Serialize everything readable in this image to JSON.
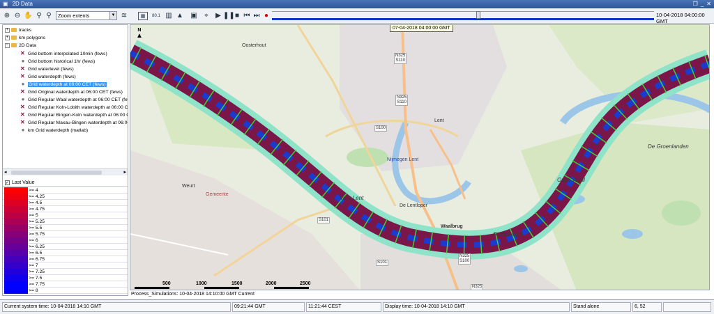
{
  "window": {
    "title": "2D Data",
    "controls": [
      "restore-icon",
      "minimize-icon",
      "close-icon"
    ]
  },
  "toolbar": {
    "zoom_select_value": "Zoom extents",
    "zoom_percent": "80.1",
    "slider_tooltip": "07-04-2018 04:00:00 GMT",
    "slider_end_label": "10-04-2018 04:00:00 GMT",
    "slider_position_fraction": 0.54,
    "icons": [
      "zoom-in-icon",
      "zoom-out-icon",
      "pan-hand-icon",
      "zoom-window-icon",
      "zoom-previous-icon",
      "layers-icon",
      "grid-icon",
      "opacity-icon",
      "triangle-icon",
      "video-icon",
      "crosshair-icon",
      "play-icon",
      "pause-icon",
      "stop-icon",
      "skip-start-icon",
      "skip-end-icon",
      "record-icon"
    ]
  },
  "tree": {
    "items": [
      {
        "label": "tracks",
        "icon": "folder-icon",
        "level": 0
      },
      {
        "label": "km polygons",
        "icon": "folder-icon",
        "level": 0
      },
      {
        "label": "2D Data",
        "icon": "folder-icon",
        "level": 0
      },
      {
        "label": "Grid bottom interpolated 10min (fews)",
        "icon": "grid-x-icon",
        "level": 1
      },
      {
        "label": "Grid bottom historical 1hr (fews)",
        "icon": "point-icon",
        "level": 1
      },
      {
        "label": "Grid waterlevel (fews)",
        "icon": "grid-x-icon",
        "level": 1
      },
      {
        "label": "Grid waterdepth (fews)",
        "icon": "grid-x-icon",
        "level": 1
      },
      {
        "label": "Grid waterdepth at 06:00 CET (fews)",
        "icon": "point-icon",
        "level": 1,
        "selected": true
      },
      {
        "label": "Grid Original waterdepth at 06:00 CET (fews)",
        "icon": "grid-x-icon",
        "level": 1
      },
      {
        "label": "Grid Regular Waal waterdepth at 06:00 CET (fews)",
        "icon": "point-icon",
        "level": 1
      },
      {
        "label": "Grid Regular Koln-Lobith waterdepth at 06:00 CET",
        "icon": "grid-x-icon",
        "level": 1
      },
      {
        "label": "Grid Regular Bingen-Koln waterdepth at 06:00 CE",
        "icon": "grid-x-icon",
        "level": 1
      },
      {
        "label": "Grid Regular Maxau-Bingen waterdepth at 06:00",
        "icon": "grid-x-icon",
        "level": 1
      },
      {
        "label": "km Grid waterdepth (matlab)",
        "icon": "point-icon",
        "level": 1
      }
    ]
  },
  "legend": {
    "header": "Last Value",
    "checked": true,
    "entries": [
      {
        "label": ">= 4",
        "color": "#ff0000"
      },
      {
        "label": ">= 4.25",
        "color": "#ee0011"
      },
      {
        "label": ">= 4.5",
        "color": "#dd0022"
      },
      {
        "label": ">= 4.75",
        "color": "#cc0033"
      },
      {
        "label": ">= 5",
        "color": "#bb0044"
      },
      {
        "label": ">= 5.25",
        "color": "#aa0055"
      },
      {
        "label": ">= 5.5",
        "color": "#990066"
      },
      {
        "label": ">= 5.75",
        "color": "#880077"
      },
      {
        "label": ">= 6",
        "color": "#770088"
      },
      {
        "label": ">= 6.25",
        "color": "#660099"
      },
      {
        "label": ">= 6.5",
        "color": "#5500aa"
      },
      {
        "label": ">= 6.75",
        "color": "#4400bb"
      },
      {
        "label": ">= 7",
        "color": "#3300cc"
      },
      {
        "label": ">= 7.25",
        "color": "#2200dd"
      },
      {
        "label": ">= 7.5",
        "color": "#1100ee"
      },
      {
        "label": ">= 7.75",
        "color": "#0000ff"
      },
      {
        "label": ">= 8",
        "color": "#0000ff"
      }
    ]
  },
  "map": {
    "north_label": "N",
    "places": {
      "veur_lent": "Veur Lent",
      "stadswaard": "Stadswaard",
      "oude_waal": "Oude Waal",
      "de_groenlanden": "De Groenlanden",
      "waalbrug": "Waalbrug",
      "nijmegen_lent": "Nijmegen Lent",
      "de_lentloper": "De Lentloper",
      "weurt": "Weurt",
      "lent": "Lent",
      "gemeente": "Gemeente",
      "oosterhout": "Oosterhout"
    },
    "roads": {
      "n325_top": "N325\nS110",
      "n325_mid": "N325\nS110",
      "s100": "S100",
      "s101_a": "S101",
      "s101_b": "S101",
      "n325_bottom": "N325\nS100",
      "n325_lower": "N325"
    },
    "scale_labels": [
      "500",
      "1000",
      "1500",
      "2000",
      "2500"
    ]
  },
  "process_text": "Process_Simulations: 10-04-2018 14:10:00 GMT Current",
  "statusbar": {
    "system_time": "Current system time: 10-04-2018 14:10 GMT",
    "gmt_time": "09:21:44 GMT",
    "cest_time": "11:21:44 CEST",
    "display_time": "Display time: 10-04-2018 14:10 GMT",
    "mode": "Stand alone",
    "count": "6, 52"
  }
}
